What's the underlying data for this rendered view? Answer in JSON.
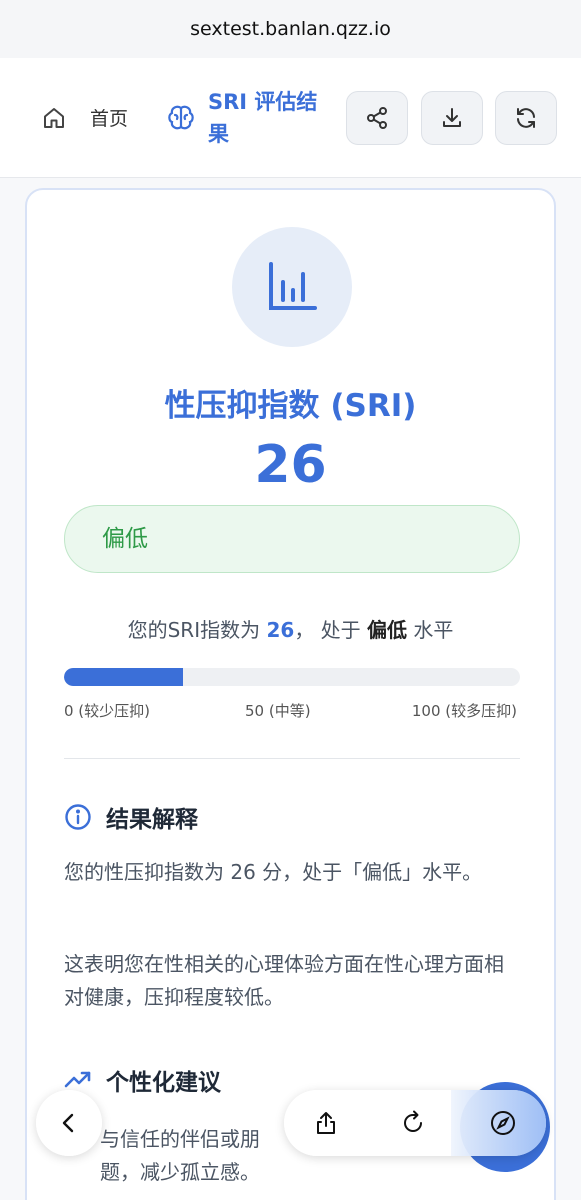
{
  "browser": {
    "url": "sextest.banlan.qzz.io"
  },
  "nav": {
    "home_label": "首页",
    "active_label": "SRI 评估结果",
    "icons": [
      "home-icon",
      "brain-icon",
      "share-icon",
      "download-icon",
      "refresh-icon"
    ]
  },
  "result": {
    "title": "性压抑指数 (SRI)",
    "score": "26",
    "level": "偏低",
    "summary": {
      "prefix": "您的SRI指数为",
      "score": "26",
      "middle": "， 处于",
      "level": "偏低",
      "suffix": "水平"
    },
    "progress_fraction": 0.26,
    "scale": {
      "low": "0 (较少压抑)",
      "mid": "50 (中等)",
      "high": "100 (较多压抑)"
    },
    "colors": {
      "accent": "#3b6fd8",
      "level_text": "#2e9a47",
      "level_bg": "#ebf8ee"
    }
  },
  "interpretation": {
    "heading": "结果解释",
    "p1": "您的性压抑指数为 26 分，处于「偏低」水平。",
    "p2": "这表明您在性相关的心理体验方面在性心理方面相对健康，压抑程度较低。"
  },
  "advice": {
    "heading": "个性化建议",
    "item1": "与信任的伴侣或朋",
    "item1_line2": "题，减少孤立感。"
  },
  "browser_toolbar": {
    "icons": [
      "back-icon",
      "share-icon",
      "reload-icon",
      "compass-icon"
    ]
  }
}
